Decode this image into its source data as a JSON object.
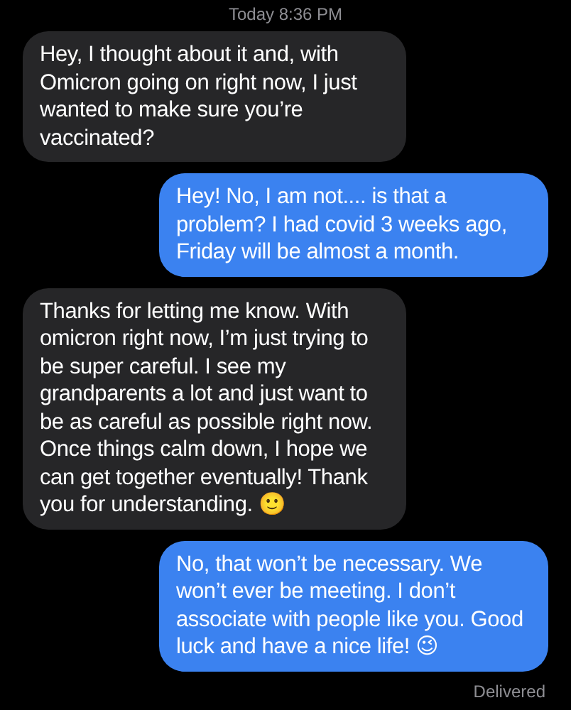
{
  "timestamp": "Today 8:36 PM",
  "messages": [
    {
      "kind": "received",
      "text": "Hey, I thought about it and, with Omicron going on right now, I just wanted to make sure you’re vaccinated?"
    },
    {
      "kind": "sent",
      "text": "Hey! No, I am not.... is that a problem? I had covid 3 weeks ago, Friday will be almost a month."
    },
    {
      "kind": "received",
      "text": "Thanks for letting me know. With omicron right now, I’m just trying to be super careful. I see my grandparents a lot and just want to be as careful as possible right now. Once things calm down, I hope we can get together eventually! Thank you for understanding. 🙂"
    },
    {
      "kind": "sent",
      "text": "No, that won’t be necessary. We won’t ever be meeting. I don’t associate with people like you. Good luck and have a nice life! 😉"
    }
  ],
  "receipt": "Delivered"
}
